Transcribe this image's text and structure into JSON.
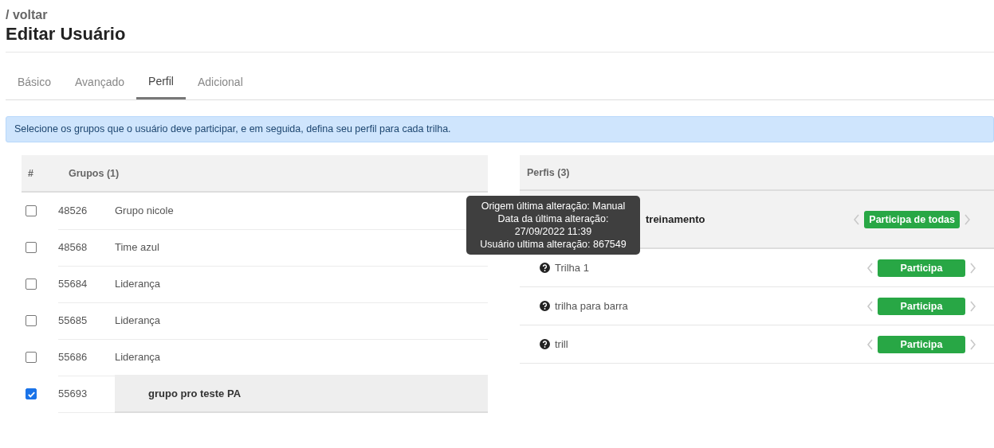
{
  "back_link": "/ voltar",
  "title": "Editar Usuário",
  "tabs": [
    {
      "label": "Básico",
      "selected": false
    },
    {
      "label": "Avançado",
      "selected": false
    },
    {
      "label": "Perfil",
      "selected": true
    },
    {
      "label": "Adicional",
      "selected": false
    }
  ],
  "info": "Selecione os grupos que o usuário deve participar, e em seguida, defina seu perfil para cada trilha.",
  "groups_table": {
    "columns": [
      "#",
      "Grupos (1)"
    ],
    "rows": [
      {
        "checked": false,
        "id": "48526",
        "name": "Grupo nicole"
      },
      {
        "checked": false,
        "id": "48568",
        "name": "Time azul"
      },
      {
        "checked": false,
        "id": "55684",
        "name": "Liderança"
      },
      {
        "checked": false,
        "id": "55685",
        "name": "Liderança"
      },
      {
        "checked": false,
        "id": "55686",
        "name": "Liderança"
      },
      {
        "checked": true,
        "id": "55693",
        "name": "grupo pro teste PA"
      }
    ]
  },
  "profiles": {
    "title": "Perfis (3)",
    "group": {
      "label": "treinamento",
      "value": "Participa de todas"
    },
    "tracks": [
      {
        "name": "Trilha 1",
        "value": "Participa"
      },
      {
        "name": "trilha para barra",
        "value": "Participa"
      },
      {
        "name": "trill",
        "value": "Participa"
      }
    ]
  },
  "tooltip": [
    "Origem última alteração: Manual",
    "Data da última alteração:",
    "27/09/2022 11:39",
    "Usuário ultima alteração: 867549"
  ]
}
